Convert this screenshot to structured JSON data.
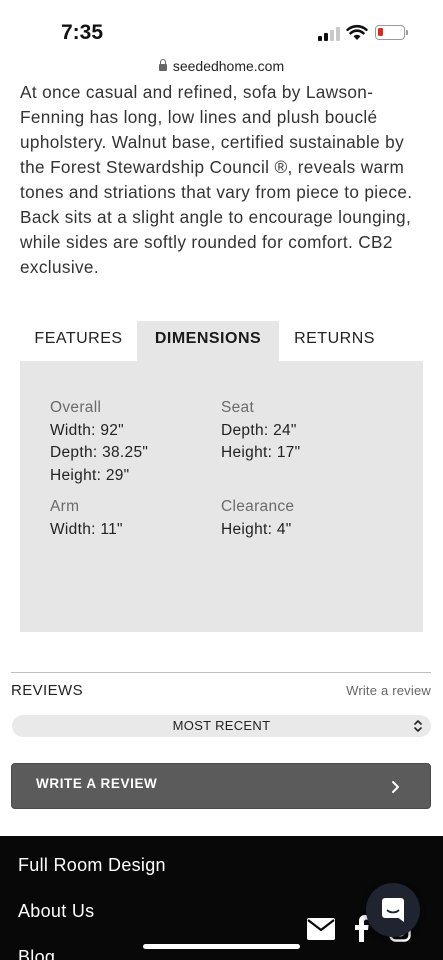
{
  "status_bar": {
    "time": "7:35"
  },
  "browser": {
    "url": "seededhome.com"
  },
  "product": {
    "description": "At once casual and refined, sofa by Lawson-Fenning has long, low lines and plush bouclé upholstery. Walnut base, certified sustainable by the Forest Stewardship Council ®, reveals warm tones and striations that vary from piece to piece. Back sits at a slight angle to encourage lounging, while sides are softly rounded for comfort. CB2 exclusive."
  },
  "tabs": {
    "features": "FEATURES",
    "dimensions": "DIMENSIONS",
    "returns": "RETURNS",
    "active": "dimensions"
  },
  "dimensions": {
    "overall": {
      "title": "Overall",
      "width": "Width: 92\"",
      "depth": "Depth: 38.25\"",
      "height": "Height: 29\""
    },
    "seat": {
      "title": "Seat",
      "depth": "Depth: 24\"",
      "height": "Height: 17\""
    },
    "arm": {
      "title": "Arm",
      "width": "Width: 11\""
    },
    "clearance": {
      "title": "Clearance",
      "height": "Height: 4\""
    }
  },
  "reviews": {
    "heading": "REVIEWS",
    "write_link": "Write a review",
    "sort_selected": "MOST RECENT",
    "write_button": "WRITE A REVIEW"
  },
  "footer": {
    "links": [
      "Full Room Design",
      "About Us",
      "Blog"
    ],
    "icons": [
      "mail-icon",
      "facebook-icon",
      "instagram-icon"
    ]
  },
  "colors": {
    "panel": "#e6e6e6",
    "button": "#5b5b5b",
    "footer": "#080808",
    "battery_low": "#e0281e"
  }
}
